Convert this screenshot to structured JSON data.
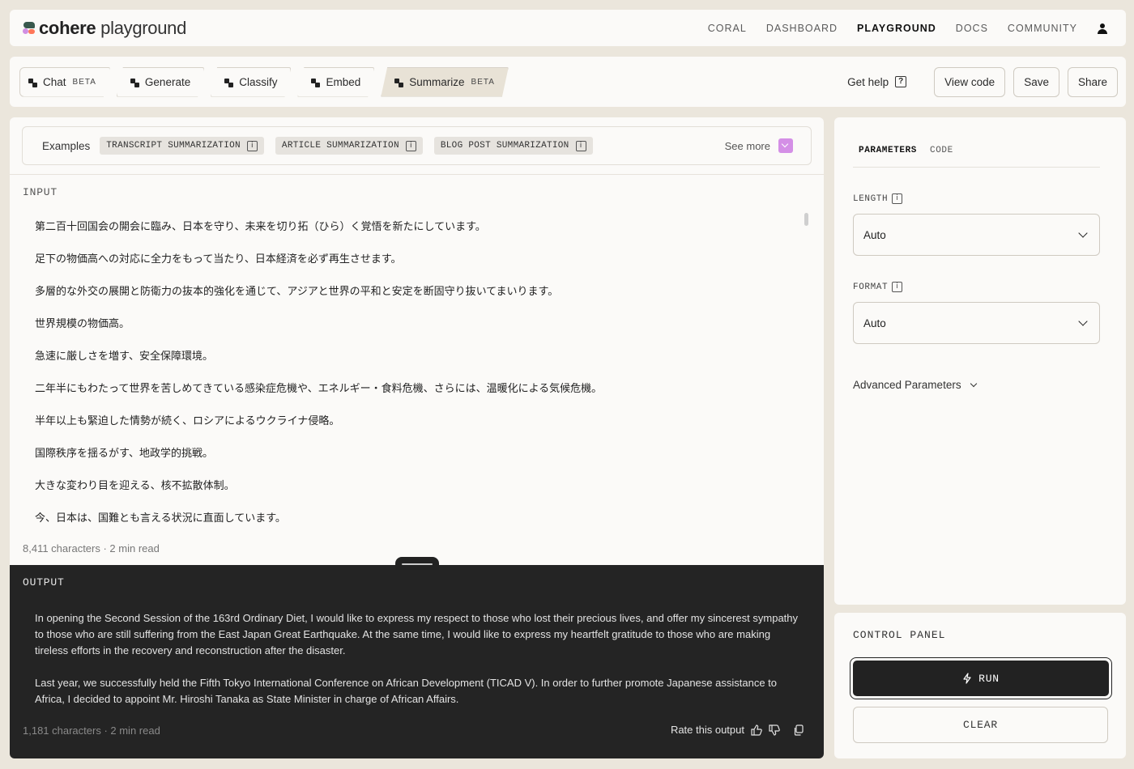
{
  "brand": {
    "name_bold": "cohere",
    "name_rest": " playground"
  },
  "nav": {
    "links": [
      "CORAL",
      "DASHBOARD",
      "PLAYGROUND",
      "DOCS",
      "COMMUNITY"
    ],
    "active": "PLAYGROUND"
  },
  "toolbar": {
    "tabs": [
      {
        "label": "Chat",
        "badge": "BETA"
      },
      {
        "label": "Generate",
        "badge": ""
      },
      {
        "label": "Classify",
        "badge": ""
      },
      {
        "label": "Embed",
        "badge": ""
      },
      {
        "label": "Summarize",
        "badge": "BETA"
      }
    ],
    "active_tab": "Summarize",
    "help_label": "Get help",
    "help_icon_glyph": "?",
    "view_code_label": "View code",
    "save_label": "Save",
    "share_label": "Share"
  },
  "examples": {
    "label": "Examples",
    "chips": [
      "TRANSCRIPT SUMMARIZATION",
      "ARTICLE SUMMARIZATION",
      "BLOG POST SUMMARIZATION"
    ],
    "see_more_label": "See more",
    "info_glyph": "i"
  },
  "input": {
    "label": "INPUT",
    "lines": [
      "第二百十回国会の開会に臨み、日本を守り、未来を切り拓（ひら）く覚悟を新たにしています。",
      "足下の物価高への対応に全力をもって当たり、日本経済を必ず再生させます。",
      "多層的な外交の展開と防衛力の抜本的強化を通じて、アジアと世界の平和と安定を断固守り抜いてまいります。",
      "世界規模の物価高。",
      "急速に厳しさを増す、安全保障環境。",
      "二年半にもわたって世界を苦しめてきている感染症危機や、エネルギー・食料危機、さらには、温暖化による気候危機。",
      "半年以上も緊迫した情勢が続く、ロシアによるウクライナ侵略。",
      "国際秩序を揺るがす、地政学的挑戦。",
      "大きな変わり目を迎える、核不拡散体制。",
      "今、日本は、国難とも言える状況に直面しています。"
    ],
    "count": "8,411 characters · 2 min read"
  },
  "output": {
    "label": "OUTPUT",
    "paragraphs": [
      "In opening the Second Session of the 163rd Ordinary Diet, I would like to express my respect to those who lost their precious lives, and offer my sincerest sympathy to those who are still suffering from the East Japan Great Earthquake. At the same time, I would like to express my heartfelt gratitude to those who are making tireless efforts in the recovery and reconstruction after the disaster.",
      "Last year, we successfully held the Fifth Tokyo International Conference on African Development (TICAD V). In order to further promote Japanese assistance to Africa, I decided to appoint Mr. Hiroshi Tanaka as State Minister in charge of African Affairs."
    ],
    "count": "1,181 characters · 2 min read",
    "rate_label": "Rate this output"
  },
  "parameters": {
    "tabs": [
      "PARAMETERS",
      "CODE"
    ],
    "active_tab": "PARAMETERS",
    "length": {
      "label": "LENGTH",
      "value": "Auto"
    },
    "format": {
      "label": "FORMAT",
      "value": "Auto"
    },
    "advanced_label": "Advanced Parameters"
  },
  "control_panel": {
    "label": "CONTROL PANEL",
    "run_label": "RUN",
    "clear_label": "CLEAR"
  },
  "colors": {
    "background": "#ebe6dc",
    "panel": "#fbfaf8",
    "dark": "#242424",
    "accent_purple": "#d48fe6",
    "logo_green": "#39594d",
    "logo_coral": "#ff7759"
  }
}
